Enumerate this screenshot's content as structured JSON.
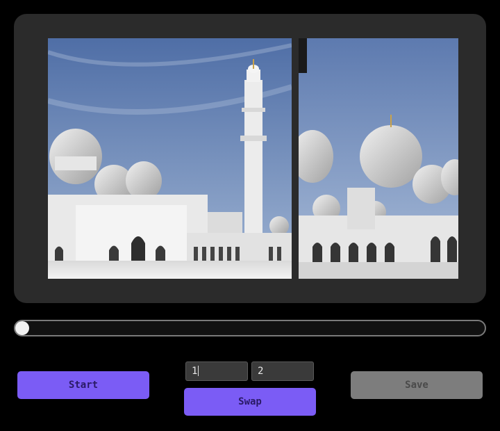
{
  "images": {
    "left": {
      "description_icon": "mosque-photo"
    },
    "right": {
      "description_icon": "mosque-photo"
    }
  },
  "slider": {
    "value": 0
  },
  "controls": {
    "start_label": "Start",
    "swap_label": "Swap",
    "save_label": "Save",
    "index_a": "1",
    "index_b": "2"
  },
  "colors": {
    "accent": "#7b5cf5",
    "disabled": "#7d7d7d",
    "panel": "#2b2b2b"
  }
}
